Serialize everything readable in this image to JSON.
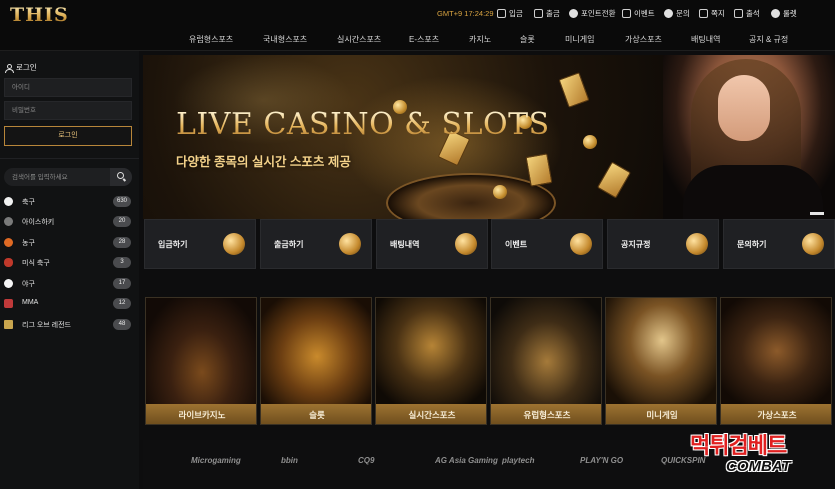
{
  "header": {
    "logo": "THIS",
    "clock": "GMT+9 17:24:29",
    "utility": [
      {
        "label": "입금",
        "icon": "deposit-icon"
      },
      {
        "label": "출금",
        "icon": "withdraw-icon"
      },
      {
        "label": "포인트전환",
        "icon": "point-icon"
      },
      {
        "label": "이벤트",
        "icon": "gift-icon"
      },
      {
        "label": "문의",
        "icon": "inquiry-icon"
      },
      {
        "label": "쪽지",
        "icon": "mail-icon"
      },
      {
        "label": "출석",
        "icon": "calendar-check-icon"
      },
      {
        "label": "룰렛",
        "icon": "roulette-icon"
      }
    ]
  },
  "nav": [
    "유럽형스포츠",
    "국내형스포츠",
    "실시간스포츠",
    "E-스포츠",
    "카지노",
    "슬롯",
    "미니게임",
    "가상스포츠",
    "배팅내역",
    "공지 & 규정"
  ],
  "sidebar": {
    "login_title": "로그인",
    "id_placeholder": "아이디",
    "pw_placeholder": "비밀번호",
    "login_button": "로그인",
    "search_placeholder": "검색어를 입력하세요",
    "sports": [
      {
        "label": "축구",
        "count": "630",
        "color": "#f2f2f2"
      },
      {
        "label": "아이스하키",
        "count": "20",
        "color": "#7a7a7a"
      },
      {
        "label": "농구",
        "count": "28",
        "color": "#e06a24"
      },
      {
        "label": "미식 축구",
        "count": "3",
        "color": "#c0392b"
      },
      {
        "label": "야구",
        "count": "17",
        "color": "#f5f5f5"
      },
      {
        "label": "MMA",
        "count": "12",
        "color": "#c03a3a"
      },
      {
        "label": "리그 오브 레전드",
        "count": "48",
        "color": "#c9a54e"
      }
    ]
  },
  "banner": {
    "title": "LIVE CASINO & SLOTS",
    "subtitle": "다양한 종목의 실시간 스포츠 제공"
  },
  "quick": [
    "입금하기",
    "출금하기",
    "배팅내역",
    "이벤트",
    "공지규정",
    "문의하기"
  ],
  "games": [
    "라이브카지노",
    "슬롯",
    "실시간스포츠",
    "유럽형스포츠",
    "미니게임",
    "가상스포츠"
  ],
  "providers": [
    "Microgaming",
    "bbin",
    "CQ9",
    "AG Asia Gaming",
    "playtech",
    "PLAY'N GO",
    "QUICKSPIN"
  ],
  "watermark": {
    "line1": "먹튀검베트",
    "line2": "COMBAT"
  }
}
